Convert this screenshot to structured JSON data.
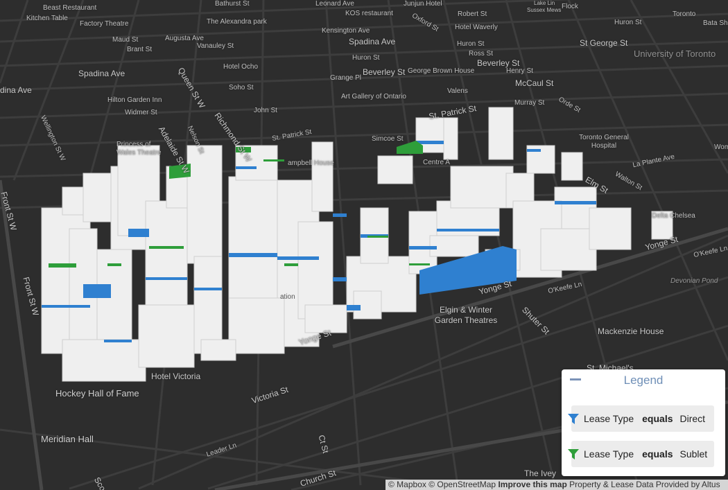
{
  "map": {
    "labels": {
      "beast_restaurant": "Beast Restaurant",
      "kitchen_table": "Kitchen Table",
      "bathurst_st": "Bathurst St",
      "factory_theatre": "Factory Theatre",
      "alexandra_park": "The Alexandra park",
      "maud_st": "Maud St",
      "augusta_ave": "Augusta Ave",
      "vanauley_st": "Vanauley St",
      "brant_st": "Brant St",
      "spadina_ave_w": "Spadina Ave",
      "queen_st_w": "Queen St W",
      "hotel_ocho": "Hotel Ocho",
      "soho_st": "Soho St",
      "dina_ave": "dina Ave",
      "hilton_garden_inn": "Hilton Garden Inn",
      "widmer_st": "Widmer St",
      "john_st": "John St",
      "wellington_st_w": "Wellington St W",
      "adelaide_st_w": "Adelaide St W",
      "nelson_st": "Nelson St",
      "richmond_st_w": "Richmond St W",
      "st_patrick_st": "St. Patrick St",
      "campbell_house": "ampbell House",
      "princess_wales": "Princess of Wales Theatre",
      "front_st_w_1": "Front St W",
      "front_st_w_2": "Front St W",
      "leonard_ave": "Leonard Ave",
      "junjun_hotel": "Junjun Hotel",
      "kos_restaurant": "KOS restaurant",
      "kensington_ave": "Kensington Ave",
      "oxford_st": "Oxford St",
      "robert_st": "Robert St",
      "hotel_waverly": "Hotel Waverly",
      "spadina_ave": "Spadina Ave",
      "huron_st_1": "Huron St",
      "huron_st_2": "Huron St",
      "huron_st_3": "Huron St",
      "ross_st": "Ross St",
      "grange_pl": "Grange Pl",
      "beverley_st_1": "Beverley St",
      "beverley_st_2": "Beverley St",
      "george_brown_house": "George Brown House",
      "henry_st": "Henry St",
      "art_gallery": "Art Gallery of Ontario",
      "valens": "Valens",
      "mccaul_st": "McCaul St",
      "murray_st": "Murray St",
      "orde_st": "Orde St",
      "st_patrick_st_2": "St. Patrick St",
      "simcoe_st": "Simcoe St",
      "centre_ave": "Centre A",
      "st_george_st": "St George St",
      "university_toronto": "University of Toronto",
      "huron_st_top": "Huron St",
      "flock": "Flock",
      "sussex_mews": "Sussex Mews",
      "lake_lin": "Lake Lin",
      "toronto_west": "Toronto",
      "bata_shoe": "Bata Sho",
      "toronto_general": "Toronto General Hospital",
      "wom": "Wom",
      "la_plante_ave": "La Plante Ave",
      "walton_st": "Walton St",
      "elm_st": "Elm St",
      "delta_chelsea": "Delta Chelsea",
      "yonge_st_1": "Yonge St",
      "yonge_st_2": "Yonge St",
      "yonge_st_3": "Yonge St",
      "okeefe_ln_1": "O'Keefe Ln",
      "okeefe_ln_2": "O'Keefe Ln",
      "devonian_pond": "Devonian Pond",
      "elgin_winter": "Elgin & Winter Garden Theatres",
      "shuter_st": "Shuter St",
      "mackenzie_house": "Mackenzie House",
      "st_michaels": "St. Michael's",
      "hotel_victoria": "Hotel Victoria",
      "hockey_hall": "Hockey Hall of Fame",
      "victoria_st": "Victoria St",
      "meridian_hall": "Meridian Hall",
      "leader_ln": "Leader Ln",
      "ct_st": "Ct St",
      "church_st": "Church St",
      "ivey": "The Ivey",
      "sco": "Sco",
      "nation": "ation"
    },
    "colors": {
      "background": "#2d2d2d",
      "road": "#3f3f3f",
      "major_road": "#4a4a4a",
      "building": "#f2f2f2",
      "direct": "#2f80d0",
      "sublet": "#2e9e3a"
    }
  },
  "legend": {
    "title": "Legend",
    "collapse_icon": "minus-icon",
    "filters": [
      {
        "icon": "filter-icon",
        "color": "#2f80d0",
        "field": "Lease Type",
        "operator": "equals",
        "value": "Direct"
      },
      {
        "icon": "filter-icon",
        "color": "#2e9e3a",
        "field": "Lease Type",
        "operator": "equals",
        "value": "Sublet"
      }
    ]
  },
  "attribution": {
    "mapbox": "© Mapbox",
    "osm": "© OpenStreetMap",
    "improve": "Improve this map",
    "data": "Property & Lease Data Provided by Altus"
  }
}
